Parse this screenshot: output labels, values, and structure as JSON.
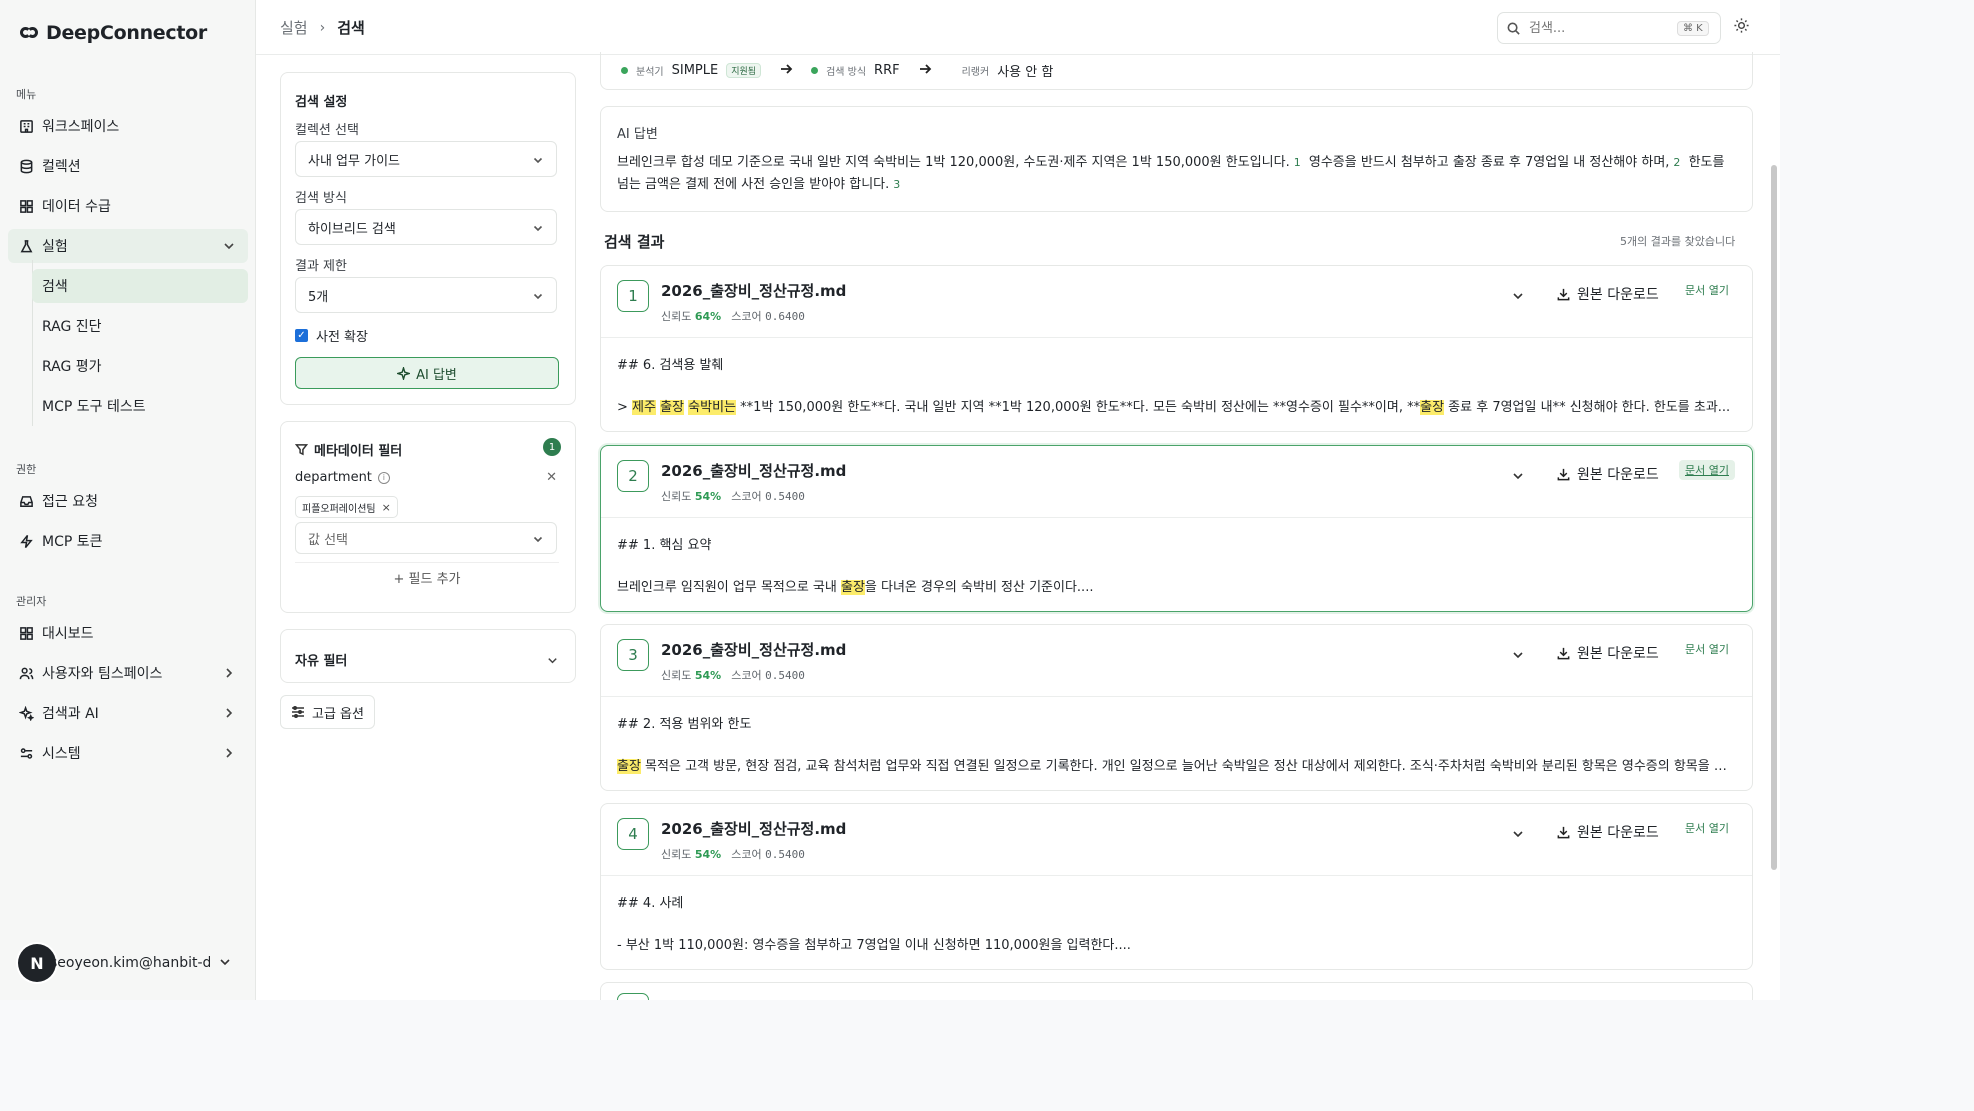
{
  "app": {
    "name": "DeepConnector"
  },
  "sidebar": {
    "sections": {
      "menu": "메뉴",
      "perm": "권한",
      "admin": "관리자"
    },
    "items": [
      {
        "label": "워크스페이스"
      },
      {
        "label": "컬렉션"
      },
      {
        "label": "데이터 수급"
      },
      {
        "label": "실험"
      }
    ],
    "sub_items": [
      {
        "label": "검색"
      },
      {
        "label": "RAG 진단"
      },
      {
        "label": "RAG 평가"
      },
      {
        "label": "MCP 도구 테스트"
      }
    ],
    "perm_items": [
      {
        "label": "접근 요청"
      },
      {
        "label": "MCP 토큰"
      }
    ],
    "admin_items": [
      {
        "label": "대시보드"
      },
      {
        "label": "사용자와 팀스페이스"
      },
      {
        "label": "검색과 AI"
      },
      {
        "label": "시스템"
      }
    ],
    "user": {
      "initial": "N",
      "email": "seoyeon.kim@hanbit-de..."
    }
  },
  "topbar": {
    "breadcrumb": [
      "실험",
      "검색"
    ],
    "search_placeholder": "검색...",
    "shortcut": "⌘ K"
  },
  "settings": {
    "title": "검색 설정",
    "collection_label": "컬렉션 선택",
    "collection_value": "사내 업무 가이드",
    "method_label": "검색 방식",
    "method_value": "하이브리드 검색",
    "limit_label": "결과 제한",
    "limit_value": "5개",
    "dict_expand": "사전 확장",
    "ai_button": "AI 답변"
  },
  "meta_filter": {
    "title": "메타데이터 필터",
    "count": "1",
    "field": "department",
    "tag": "피플오퍼레이션팀",
    "value_placeholder": "값 선택",
    "add_field": "+ 필드 추가"
  },
  "free_filter": {
    "title": "자유 필터"
  },
  "advanced": {
    "label": "고급 옵션"
  },
  "pipeline": {
    "analyzer_key": "분석기",
    "analyzer_value": "SIMPLE",
    "analyzer_badge": "지원됨",
    "method_key": "검색 방식",
    "method_value": "RRF",
    "reranker_key": "리랭커",
    "reranker_value": "사용 안 함"
  },
  "ai_answer": {
    "title": "AI 답변",
    "part1": "브레인크루 합성 데모 기준으로 국내 일반 지역 숙박비는 1박 120,000원, 수도권·제주 지역은 1박 150,000원 한도입니다.",
    "ref1": "1",
    "part2": "영수증을 반드시 첨부하고 출장 종료 후 7영업일 내 정산해야 하며,",
    "ref2": "2",
    "part3": "한도를 넘는 금액은 결제 전에 사전 승인을 받아야 합니다.",
    "ref3": "3"
  },
  "results": {
    "title": "검색 결과",
    "count_text": "5개의 결과를 찾았습니다",
    "download_label": "원본 다운로드",
    "open_label": "문서 열기",
    "conf_label": "신뢰도",
    "score_label": "스코어",
    "items": [
      {
        "num": "1",
        "file": "2026_출장비_정산규정.md",
        "confidence": "64%",
        "score": "0.6400",
        "heading": "## 6. 검색용 발췌",
        "s_pre": "> ",
        "s_h1": "제주",
        "s_h2": "출장",
        "s_h3": "숙박비는",
        "s_mid": " **1박 150,000원 한도**다. 국내 일반 지역 **1박 120,000원 한도**다. 모든 숙박비 정산에는 **영수증이 필수**이며, **",
        "s_h4": "출장",
        "s_post": " 종료 후 7영업일 내** 신청해야 한다. 한도를 초과..."
      },
      {
        "num": "2",
        "file": "2026_출장비_정산규정.md",
        "confidence": "54%",
        "score": "0.5400",
        "heading": "## 1. 핵심 요약",
        "s_pre": "브레인크루 임직원이 업무 목적으로 국내 ",
        "s_h1": "출장",
        "s_post": "을 다녀온 경우의 숙박비 정산 기준이다...."
      },
      {
        "num": "3",
        "file": "2026_출장비_정산규정.md",
        "confidence": "54%",
        "score": "0.5400",
        "heading": "## 2. 적용 범위와 한도",
        "s_h1": "출장",
        "s_post": " 목적은 고객 방문, 현장 점검, 교육 참석처럼 업무와 직접 연결된 일정으로 기록한다. 개인 일정으로 늘어난 숙박일은 정산 대상에서 제외한다. 조식·주차처럼 숙박비와 분리된 항목은 영수증의 항목을 확..."
      },
      {
        "num": "4",
        "file": "2026_출장비_정산규정.md",
        "confidence": "54%",
        "score": "0.5400",
        "heading": "## 4. 사례",
        "s_post": "- 부산 1박 110,000원: 영수증을 첨부하고 7영업일 이내 신청하면 110,000원을 입력한다...."
      }
    ]
  },
  "colors": {
    "accent": "#2e7d4f",
    "highlight": "#fcec6a",
    "active_bg": "#e2eee4"
  }
}
